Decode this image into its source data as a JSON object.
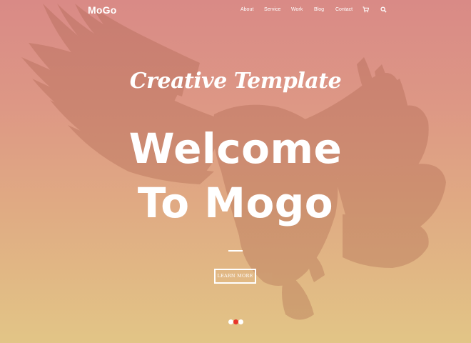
{
  "brand": {
    "logo": "MoGo"
  },
  "nav": {
    "items": [
      {
        "label": "About"
      },
      {
        "label": "Service"
      },
      {
        "label": "Work"
      },
      {
        "label": "Blog"
      },
      {
        "label": "Contact"
      }
    ],
    "icons": [
      "cart-icon",
      "search-icon"
    ]
  },
  "hero": {
    "subtitle": "Creative Template",
    "title_line1": "Welcome",
    "title_line2": "To Mogo",
    "button_label": "LEARN MORE",
    "slider": {
      "count": 3,
      "active_index": 1
    }
  },
  "colors": {
    "gradient_top": "#d98a86",
    "gradient_bottom": "#e2c586",
    "accent_dot": "#e8352b",
    "text": "#ffffff"
  }
}
